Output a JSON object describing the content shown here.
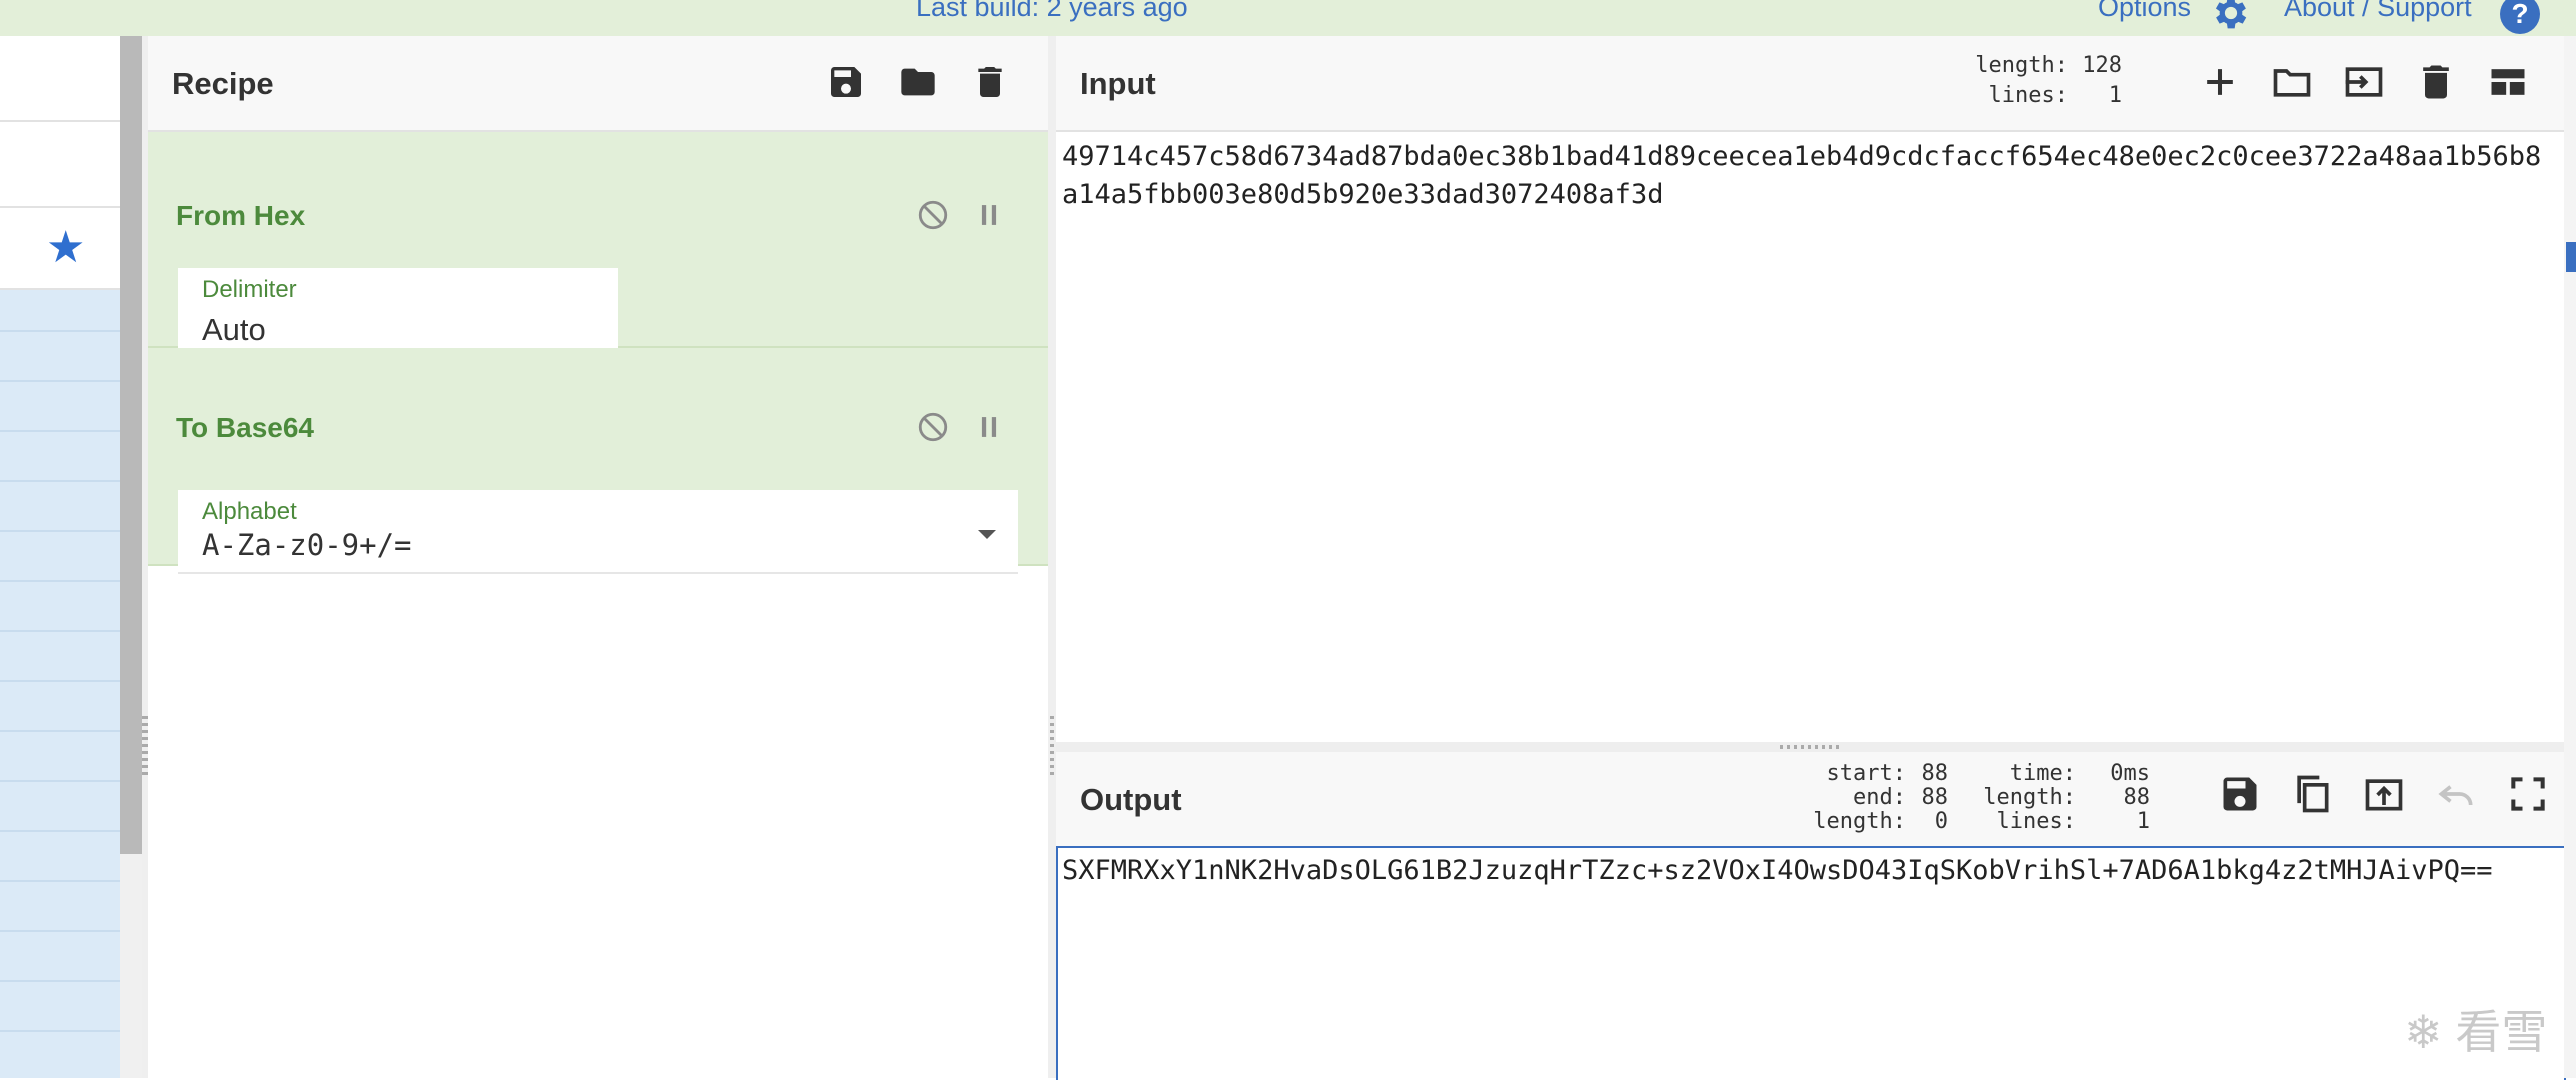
{
  "topbar": {
    "build": "Last build: 2 years ago",
    "options": "Options",
    "about": "About / Support",
    "help_glyph": "?"
  },
  "sidebar": {
    "favourite_icon": "star-icon",
    "favourite_color": "#2f6fcf"
  },
  "recipe": {
    "title": "Recipe",
    "icons": [
      "save-icon",
      "folder-icon",
      "trash-icon"
    ],
    "operations": [
      {
        "name": "From Hex",
        "field_label": "Delimiter",
        "field_value": "Auto"
      },
      {
        "name": "To Base64",
        "field_label": "Alphabet",
        "field_value": "A-Za-z0-9+/="
      }
    ]
  },
  "input": {
    "title": "Input",
    "length_label": "length:",
    "length_value": "128",
    "lines_label": "lines:",
    "lines_value": "1",
    "icons": [
      "plus-icon",
      "folder-icon",
      "import-icon",
      "trash-icon",
      "layout-icon"
    ],
    "text": "49714c457c58d6734ad87bda0ec38b1bad41d89ceecea1eb4d9cdcfaccf654ec48e0ec2c0cee3722a48aa1b56b8a14a5fbb003e80d5b920e33dad3072408af3d"
  },
  "output": {
    "title": "Output",
    "start_label": "start:",
    "start_value": "88",
    "end_label": "end:",
    "end_value": "88",
    "length_label": "length:",
    "length_value": "0",
    "time_label": "time:",
    "time_value": "0ms",
    "length2_label": "length:",
    "length2_value": "88",
    "lines_label": "lines:",
    "lines_value": "1",
    "icons": [
      "save-icon",
      "copy-icon",
      "replace-input-icon",
      "undo-icon",
      "maximise-icon"
    ],
    "text": "SXFMRXxY1nNK2HvaDsOLG61B2JzuzqHrTZzc+sz2VOxI4OwsDO43IqSKobVrihSl+7AD6A1bkg4z2tMHJAivPQ=="
  },
  "watermark": "看雪",
  "colors": {
    "accent": "#3a6fc0",
    "operation_bg": "#e2efd9",
    "operation_text": "#4c8a3c"
  }
}
